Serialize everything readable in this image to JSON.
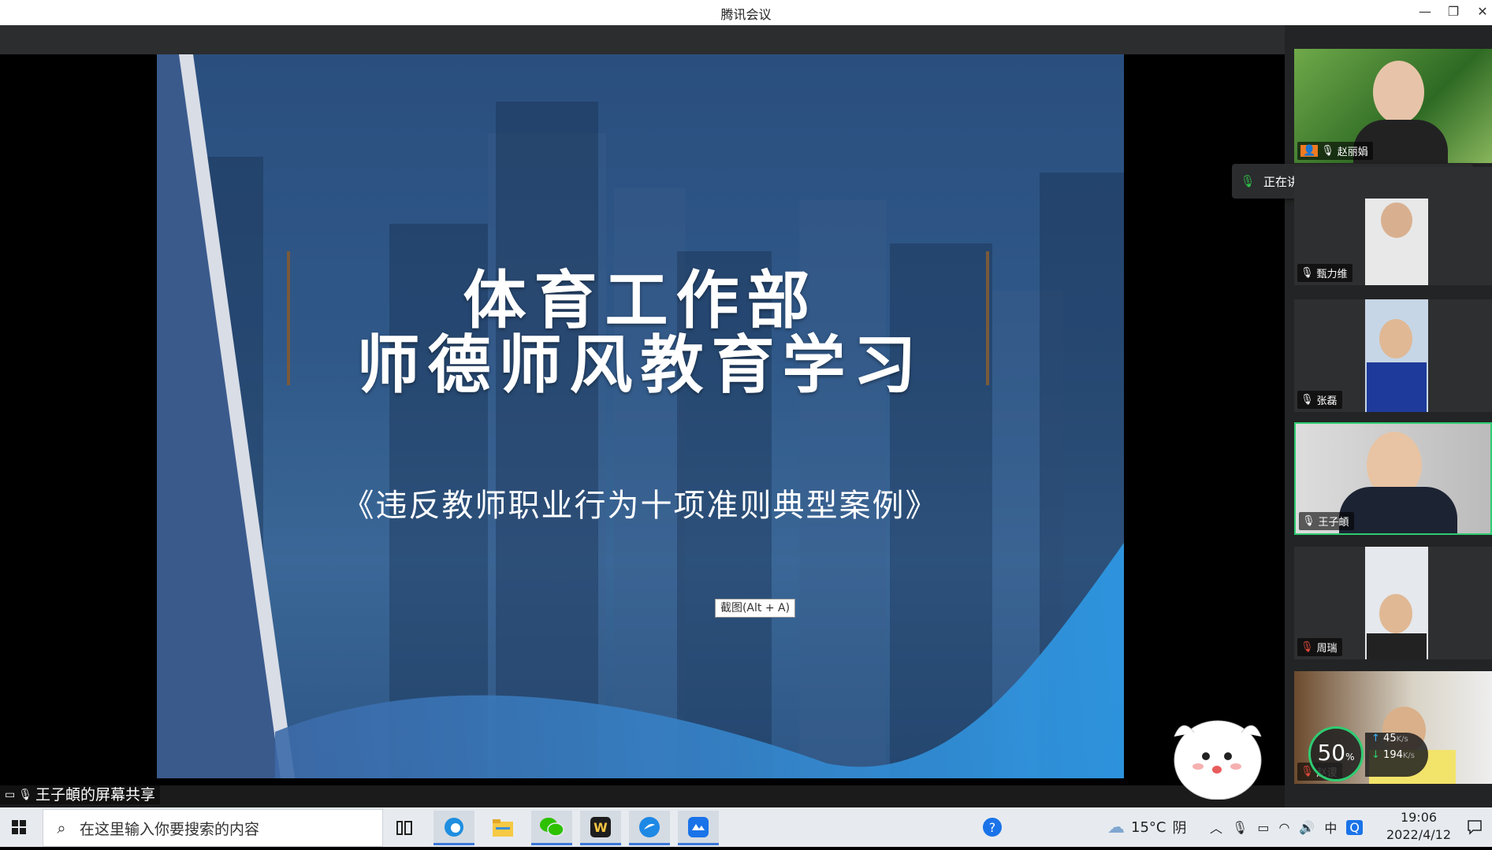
{
  "window": {
    "title": "腾讯会议"
  },
  "slide": {
    "title_line1": "体育工作部",
    "title_line2": "师德师风教育学习",
    "subtitle": "《违反教师职业行为十项准则典型案例》"
  },
  "screenshot_tip": "截图(Alt + A)",
  "share_label": "王子頔的屏幕共享",
  "speaking_banner": "正在讲话: 王子頔; 赵丽娟;...",
  "participants": [
    {
      "name": "赵丽娟"
    },
    {
      "name": "甄力维"
    },
    {
      "name": "张磊"
    },
    {
      "name": "王子頔"
    },
    {
      "name": "周瑞"
    },
    {
      "name": "赵谡"
    }
  ],
  "network": {
    "percent": "50",
    "percent_unit": "%",
    "upload": "45",
    "upload_unit": "K/s",
    "download": "194",
    "download_unit": "K/s"
  },
  "taskbar": {
    "search_placeholder": "在这里输入你要搜索的内容",
    "weather_temp": "15°C",
    "weather_cond": "阴",
    "ime": "中",
    "time": "19:06",
    "date": "2022/4/12"
  }
}
